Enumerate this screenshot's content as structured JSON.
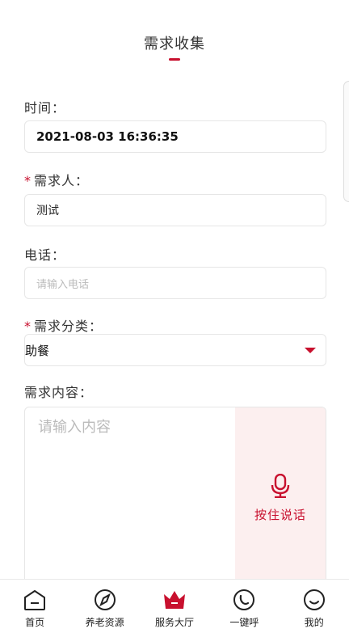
{
  "header": {
    "title": "需求收集"
  },
  "form": {
    "time_label": "时间：",
    "time_value": "2021-08-03 16:36:35",
    "requester_label": "需求人：",
    "requester_value": "测试",
    "phone_label": "电话：",
    "phone_placeholder": "请输入电话",
    "category_label": "需求分类：",
    "category_value": "助餐",
    "content_label": "需求内容：",
    "content_placeholder": "请输入内容",
    "required_mark": "*",
    "voice_label": "按住说话"
  },
  "tabbar": {
    "items": [
      {
        "label": "首页",
        "icon": "home-icon"
      },
      {
        "label": "养老资源",
        "icon": "compass-icon"
      },
      {
        "label": "服务大厅",
        "icon": "crown-icon"
      },
      {
        "label": "一键呼",
        "icon": "phone-icon"
      },
      {
        "label": "我的",
        "icon": "smile-icon"
      }
    ]
  },
  "colors": {
    "accent": "#c8102e",
    "voice_bg": "#fcefef"
  }
}
